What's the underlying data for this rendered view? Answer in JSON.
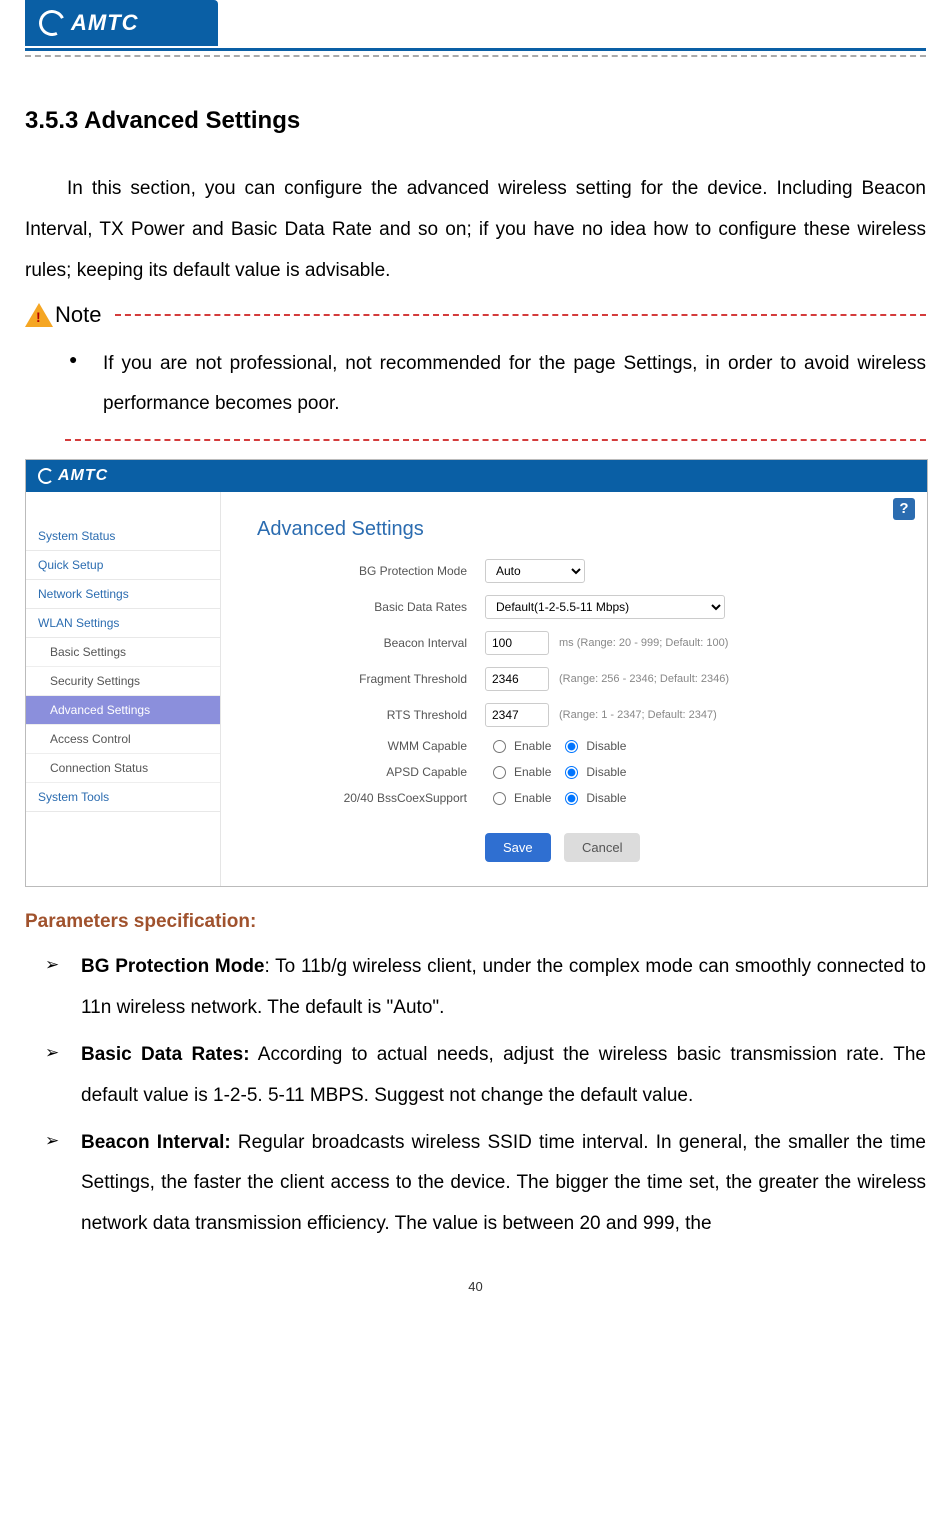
{
  "header": {
    "brand": "AMTC"
  },
  "section": {
    "number_title": "3.5.3 Advanced Settings",
    "intro": "In this section, you can configure the advanced wireless setting for the device. Including Beacon Interval, TX Power and Basic Data Rate and so on; if you have no idea how to configure these wireless rules; keeping its default value is advisable."
  },
  "note": {
    "label": "Note",
    "item": "If you are not professional, not recommended for the page Settings, in order to avoid wireless performance becomes poor."
  },
  "admin": {
    "brand": "AMTC",
    "help": "?",
    "panel_title": "Advanced Settings",
    "sidebar": {
      "items": [
        "System Status",
        "Quick Setup",
        "Network Settings",
        "WLAN Settings"
      ],
      "subs": [
        "Basic Settings",
        "Security Settings",
        "Advanced Settings",
        "Access Control",
        "Connection Status"
      ],
      "item_last": "System Tools"
    },
    "form": {
      "bg_label": "BG Protection Mode",
      "bg_value": "Auto",
      "rates_label": "Basic Data Rates",
      "rates_value": "Default(1-2-5.5-11 Mbps)",
      "beacon_label": "Beacon Interval",
      "beacon_value": "100",
      "beacon_hint": "ms (Range: 20 - 999; Default: 100)",
      "frag_label": "Fragment Threshold",
      "frag_value": "2346",
      "frag_hint": "(Range: 256 - 2346; Default: 2346)",
      "rts_label": "RTS Threshold",
      "rts_value": "2347",
      "rts_hint": "(Range: 1 - 2347; Default: 2347)",
      "wmm_label": "WMM Capable",
      "apsd_label": "APSD Capable",
      "bss_label": "20/40 BssCoexSupport",
      "enable": "Enable",
      "disable": "Disable",
      "save": "Save",
      "cancel": "Cancel"
    }
  },
  "params": {
    "title": "Parameters specification:",
    "items": [
      {
        "b": "BG Protection Mode",
        "t": ": To 11b/g wireless client, under the complex mode can smoothly connected to 11n wireless network. The default is \"Auto\"."
      },
      {
        "b": "Basic Data Rates:",
        "t": " According to actual needs, adjust the wireless basic transmission rate. The default value is 1-2-5. 5-11 MBPS. Suggest not change the default value."
      },
      {
        "b": "Beacon Interval:",
        "t": " Regular broadcasts wireless SSID time interval. In general, the smaller the time Settings, the faster the client access to the device. The bigger the time set, the greater the wireless network data transmission efficiency. The value is between 20 and 999, the"
      }
    ]
  },
  "page_number": "40"
}
